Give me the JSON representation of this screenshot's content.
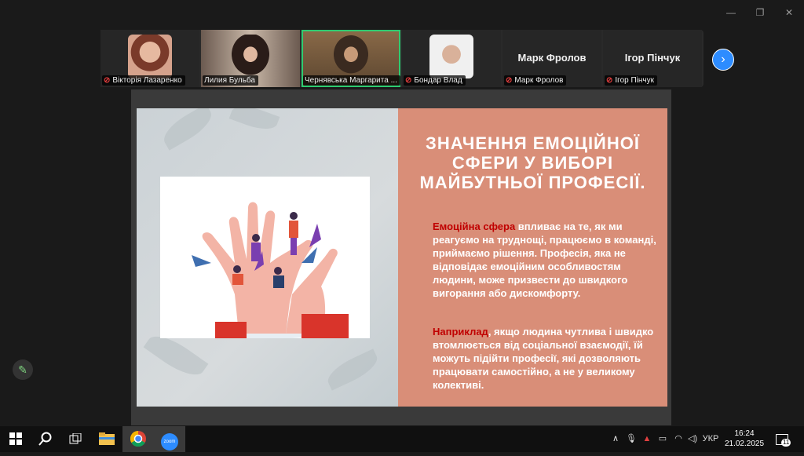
{
  "window_controls": {
    "minimize": "—",
    "restore": "❐",
    "close": "✕"
  },
  "participants": [
    {
      "name": "Вікторія Лазаренко",
      "muted": true,
      "type": "avatar"
    },
    {
      "name": "Лилия Бульба",
      "muted": false,
      "type": "video"
    },
    {
      "name": "Чернявська Маргарита ...",
      "muted": false,
      "type": "video",
      "active": true
    },
    {
      "name": "Бондар Влад",
      "muted": true,
      "type": "avatar"
    },
    {
      "name": "Марк Фролов",
      "muted": true,
      "type": "name-only",
      "display": "Марк Фролов"
    },
    {
      "name": "Ігор Пінчук",
      "muted": true,
      "type": "name-only",
      "display": "Ігор Пінчук"
    }
  ],
  "next_arrow": "›",
  "slide": {
    "title_lines": [
      "Значення емоційної",
      "сфери у виборі",
      "майбутньої професії."
    ],
    "p1_highlight": "Емоційна сфера",
    "p1_rest": " впливає на те, як ми реагуємо на труднощі, працюємо в команді, приймаємо рішення. Професія, яка не відповідає емоційним особливостям людини, може призвести до швидкого вигорання або дискомфорту.",
    "p2_highlight": "Наприклад",
    "p2_rest": ", якщо людина чутлива і швидко втомлюється від соціальної взаємодії, їй можуть підійти професії, які дозволяють працювати самостійно, а не у великому колективі."
  },
  "taskbar": {
    "zoom_label": "zoom",
    "language": "УКР",
    "time": "16:24",
    "date": "21.02.2025",
    "notifications": "11"
  },
  "colors": {
    "slide_right": "#d98e78",
    "highlight": "#c00000",
    "active_speaker": "#2ecc71",
    "zoom_blue": "#2d8cff"
  }
}
